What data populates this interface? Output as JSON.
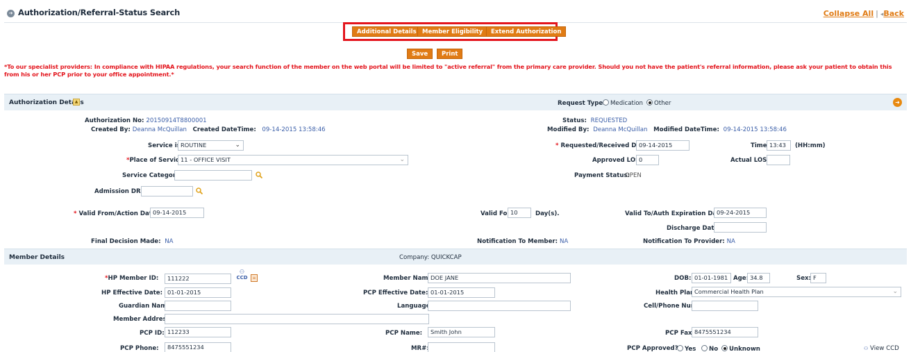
{
  "header": {
    "title": "Authorization/Referral-Status Search",
    "collapse_all": "Collapse All",
    "separator": "|",
    "back": "Back"
  },
  "actions": {
    "additional_details": "Additional Details",
    "member_eligibility": "Member Eligibility",
    "extend_authorization": "Extend Authorization",
    "save": "Save",
    "print": "Print"
  },
  "warning": "*To our specialist providers: In compliance with HIPAA regulations, your search function of the member on the web portal will be limited to \"active referral\" from the primary care provider. Should you not have the patient's referral information, please ask your patient to obtain this from his or her PCP prior to your office appointment.*",
  "auth": {
    "section_title": "Authorization Details",
    "request_type_label": "Request Type:",
    "request_type_options": [
      "Medication",
      "Other"
    ],
    "request_type_selected": "Other",
    "auth_no_label": "Authorization No:",
    "auth_no": "20150914T8800001",
    "created_by_label": "Created By:",
    "created_by": "Deanna McQuillan",
    "created_dt_label": "Created DateTime:",
    "created_dt": "09-14-2015 13:58:46",
    "status_label": "Status:",
    "status": "REQUESTED",
    "modified_by_label": "Modified By:",
    "modified_by": "Deanna McQuillan",
    "modified_dt_label": "Modified DateTime:",
    "modified_dt": "09-14-2015 13:58:46",
    "service_is_label": "Service is:",
    "service_is": "ROUTINE",
    "requested_date_label": "Requested/Received Date:",
    "requested_date": "09-14-2015",
    "time_label": "Time:",
    "time": "13:43",
    "time_format": "(HH:mm)",
    "place_label": "Place of Service:",
    "place": "11 - OFFICE VISIT",
    "approved_los_label": "Approved LOS:",
    "approved_los": "0",
    "actual_los_label": "Actual LOS:",
    "actual_los": "",
    "service_category_label": "Service Category:",
    "service_category": "",
    "payment_status_label": "Payment Status:",
    "payment_status": "OPEN",
    "admission_drg_label": "Admission DRG:",
    "admission_drg": "",
    "valid_from_label": "Valid From/Action Date:",
    "valid_from": "09-14-2015",
    "valid_for_label": "Valid For:",
    "valid_for": "10",
    "valid_for_unit": "Day(s).",
    "valid_to_label": "Valid To/Auth Expiration Date:",
    "valid_to": "09-24-2015",
    "discharge_label": "Discharge Date:",
    "discharge": "",
    "final_decision_label": "Final Decision Made:",
    "final_decision": "NA",
    "notif_member_label": "Notification To Member:",
    "notif_member": "NA",
    "notif_provider_label": "Notification To Provider:",
    "notif_provider": "NA"
  },
  "member": {
    "section_title": "Member Details",
    "company_label": "Company:",
    "company": "QUICKCAP",
    "hp_member_id_label": "HP Member ID:",
    "hp_member_id": "111222",
    "ccd_label": "CCD",
    "member_name_label": "Member Name:",
    "member_name": "DOE JANE",
    "dob_label": "DOB:",
    "dob": "01-01-1981",
    "age_label": "Age:",
    "age": "34.8",
    "sex_label": "Sex:",
    "sex": "F",
    "hp_eff_label": "HP Effective Date:",
    "hp_eff": "01-01-2015",
    "pcp_eff_label": "PCP Effective Date:",
    "pcp_eff": "01-01-2015",
    "health_plan_label": "Health Plan:",
    "health_plan": "Commercial Health Plan",
    "guardian_label": "Guardian Name:",
    "guardian": "",
    "language_label": "Language:",
    "language": "",
    "cell_label": "Cell/Phone Number:",
    "cell": "",
    "address_label": "Member Address:",
    "address": "",
    "pcp_id_label": "PCP ID:",
    "pcp_id": "112233",
    "pcp_name_label": "PCP Name:",
    "pcp_name": "Smith John",
    "pcp_fax_label": "PCP Fax:",
    "pcp_fax": "8475551234",
    "pcp_phone_label": "PCP Phone:",
    "pcp_phone": "8475551234",
    "mr_label": "MR#:",
    "mr": "",
    "pcp_approved_label": "PCP Approved?",
    "pcp_approved_options": [
      "Yes",
      "No",
      "Unknown"
    ],
    "pcp_approved_selected": "Unknown",
    "view_ccd": "View CCD"
  },
  "colors": {
    "accent": "#e07b14",
    "alert": "#e3141c",
    "link_value": "#3a5ea8",
    "section_bg": "#e8f0f6"
  }
}
